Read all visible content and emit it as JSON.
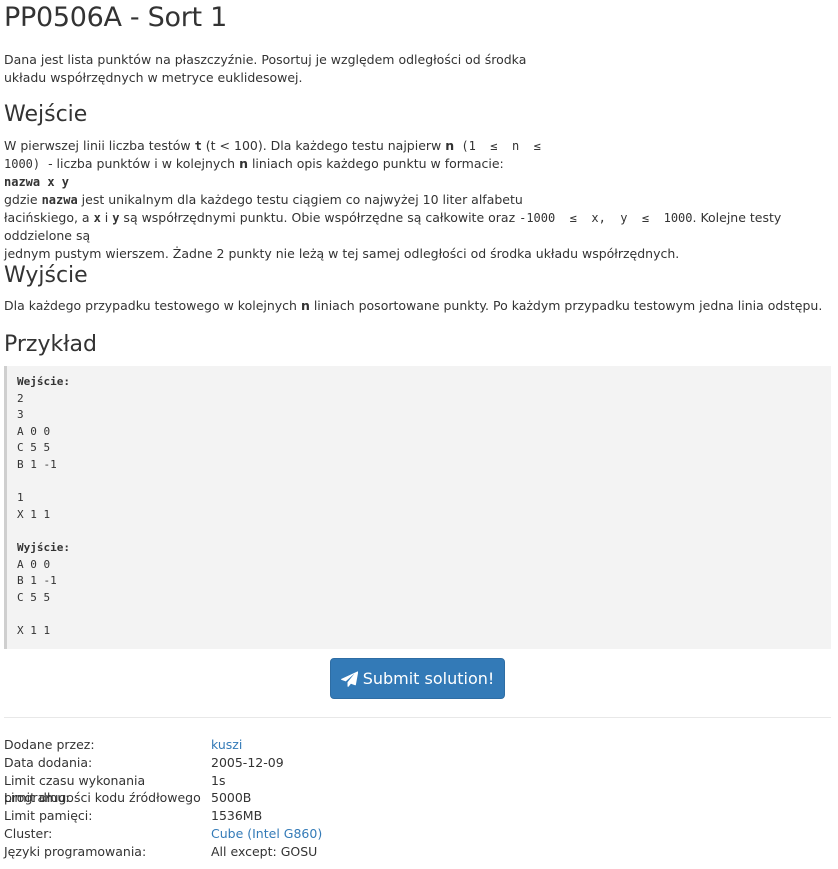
{
  "problem": {
    "title": "PP0506A - Sort 1",
    "description_line1": "Dana jest lista punktów na płaszczyźnie. Posortuj je względem odległości od środka",
    "description_line2": "układu współrzędnych w metryce euklidesowej."
  },
  "input_section": {
    "heading": "Wejście",
    "l1_a": "W pierwszej linii liczba testów ",
    "l1_t": "t",
    "l1_b": " (t < 100). Dla każdego testu najpierw ",
    "l1_n": "n",
    "l1_c": " (1  ≤  n  ≤",
    "l2_a": "1000)",
    "l2_b": "  - liczba punktów i w kolejnych ",
    "l2_n": "n",
    "l2_c": " liniach opis każdego punktu w formacie:",
    "l3_format": "nazwa x y",
    "l4_a": "gdzie ",
    "l4_nazwa": "nazwa",
    "l4_b": " jest unikalnym dla każdego testu ciągiem co najwyżej 10 liter alfabetu",
    "l5_a": "łacińskiego, a ",
    "l5_x": "x",
    "l5_b": " i ",
    "l5_y": "y",
    "l5_c": " są współrzędnymi punktu. Obie współrzędne są całkowite oraz ",
    "l5_range": "-1000  ≤  x,  y  ≤  1000",
    "l5_d": ". Kolejne testy oddzielone są",
    "l6": "jednym pustym wierszem. Żadne 2 punkty nie leżą w tej samej odległości od środka układu współrzędnych."
  },
  "output_section": {
    "heading": "Wyjście",
    "l1_a": "Dla każdego przypadku testowego w kolejnych ",
    "l1_n": "n",
    "l1_b": " liniach posortowane punkty. Po każdym przypadku testowym jedna linia odstępu."
  },
  "example": {
    "heading": "Przykład",
    "input_label": "Wejście:",
    "input_lines": [
      "2",
      "3",
      "A 0 0",
      "C 5 5",
      "B 1 -1",
      "",
      "1",
      "X 1 1"
    ],
    "output_label": "Wyjście:",
    "output_lines": [
      "A 0 0",
      "B 1 -1",
      "C 5 5",
      "",
      "X 1 1"
    ]
  },
  "submit": {
    "label": "Submit solution!",
    "icon": "paper-plane-icon",
    "color": "#337ab7"
  },
  "meta": {
    "rows": [
      {
        "key": "Dodane przez:",
        "value": "kuszi",
        "link": true
      },
      {
        "key": "Data dodania:",
        "value": "2005-12-09",
        "link": false
      },
      {
        "key": "Limit czasu wykonania programu:",
        "value": "1s",
        "link": false
      },
      {
        "key": "Limit długości kodu źródłowego",
        "value": "5000B",
        "link": false
      },
      {
        "key": "Limit pamięci:",
        "value": "1536MB",
        "link": false
      },
      {
        "key": "Cluster:",
        "value": "Cube (Intel G860)",
        "link": true
      },
      {
        "key": "Języki programowania:",
        "value": "All except: GOSU",
        "link": false
      }
    ]
  }
}
